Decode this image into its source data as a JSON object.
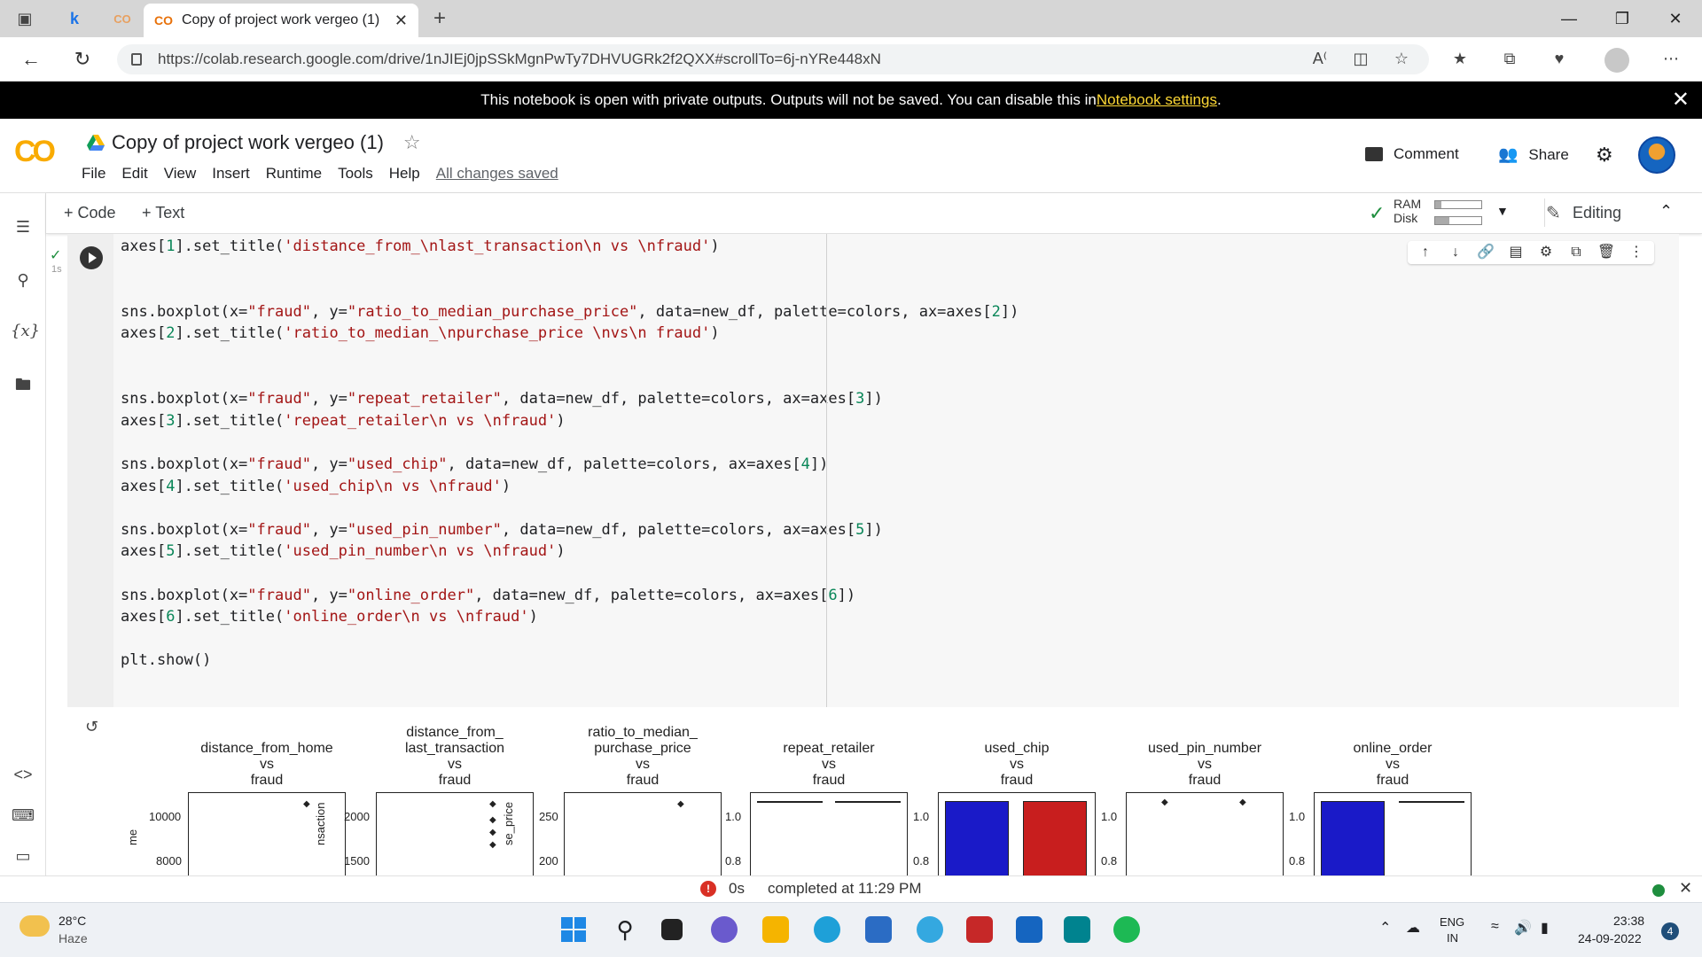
{
  "browser": {
    "tabs": [
      {
        "label": "Copy of project work vergeo (1)",
        "active": true
      }
    ],
    "url": "https://colab.research.google.com/drive/1nJIEj0jpSSkMgnPwTy7DHVUGRk2f2QXX#scrollTo=6j-nYRe448xN"
  },
  "banner": {
    "text": "This notebook is open with private outputs. Outputs will not be saved. You can disable this in ",
    "link": "Notebook settings",
    "suffix": "."
  },
  "colab": {
    "logo": "CO",
    "title": "Copy of project work vergeo (1)",
    "menu": [
      "File",
      "Edit",
      "View",
      "Insert",
      "Runtime",
      "Tools",
      "Help"
    ],
    "saved_status": "All changes saved",
    "comment_label": "Comment",
    "share_label": "Share"
  },
  "toolbar": {
    "code_label": "+ Code",
    "text_label": "+ Text",
    "ram_label": "RAM",
    "disk_label": "Disk",
    "editing_label": "Editing"
  },
  "cell": {
    "exec_time": "1s",
    "lines": [
      "axes[1].set_title('distance_from_\\nlast_transaction\\n vs \\nfraud')",
      "",
      "",
      "sns.boxplot(x=\"fraud\", y=\"ratio_to_median_purchase_price\", data=new_df, palette=colors, ax=axes[2])",
      "axes[2].set_title('ratio_to_median_\\npurchase_price \\nvs\\n fraud')",
      "",
      "",
      "sns.boxplot(x=\"fraud\", y=\"repeat_retailer\", data=new_df, palette=colors, ax=axes[3])",
      "axes[3].set_title('repeat_retailer\\n vs \\nfraud')",
      "",
      "sns.boxplot(x=\"fraud\", y=\"used_chip\", data=new_df, palette=colors, ax=axes[4])",
      "axes[4].set_title('used_chip\\n vs \\nfraud')",
      "",
      "sns.boxplot(x=\"fraud\", y=\"used_pin_number\", data=new_df, palette=colors, ax=axes[5])",
      "axes[5].set_title('used_pin_number\\n vs \\nfraud')",
      "",
      "sns.boxplot(x=\"fraud\", y=\"online_order\", data=new_df, palette=colors, ax=axes[6])",
      "axes[6].set_title('online_order\\n vs \\nfraud')",
      "",
      "plt.show()"
    ]
  },
  "output": {
    "plots": [
      {
        "title": "distance_from_home\nvs\nfraud",
        "yticks": [
          "10000",
          "8000"
        ],
        "ylabel": "me"
      },
      {
        "title": "distance_from_\nlast_transaction\nvs\nfraud",
        "yticks": [
          "2000",
          "1500"
        ],
        "ylabel": "nsaction"
      },
      {
        "title": "ratio_to_median_\npurchase_price\nvs\nfraud",
        "yticks": [
          "250",
          "200"
        ],
        "ylabel": "se_price"
      },
      {
        "title": "repeat_retailer\nvs\nfraud",
        "yticks": [
          "1.0",
          "0.8"
        ]
      },
      {
        "title": "used_chip\nvs\nfraud",
        "yticks": [
          "1.0",
          "0.8"
        ]
      },
      {
        "title": "used_pin_number\nvs\nfraud",
        "yticks": [
          "1.0",
          "0.8"
        ]
      },
      {
        "title": "online_order\nvs\nfraud",
        "yticks": [
          "1.0",
          "0.8"
        ]
      }
    ],
    "colors": {
      "class0": "#1a1ac8",
      "class1": "#c81e1e"
    }
  },
  "status": {
    "duration": "0s",
    "text": "completed at 11:29 PM"
  },
  "taskbar": {
    "weather_temp": "28°C",
    "weather_desc": "Haze",
    "lang_top": "ENG",
    "lang_bottom": "IN",
    "time": "23:38",
    "date": "24-09-2022",
    "notif_count": "4"
  }
}
